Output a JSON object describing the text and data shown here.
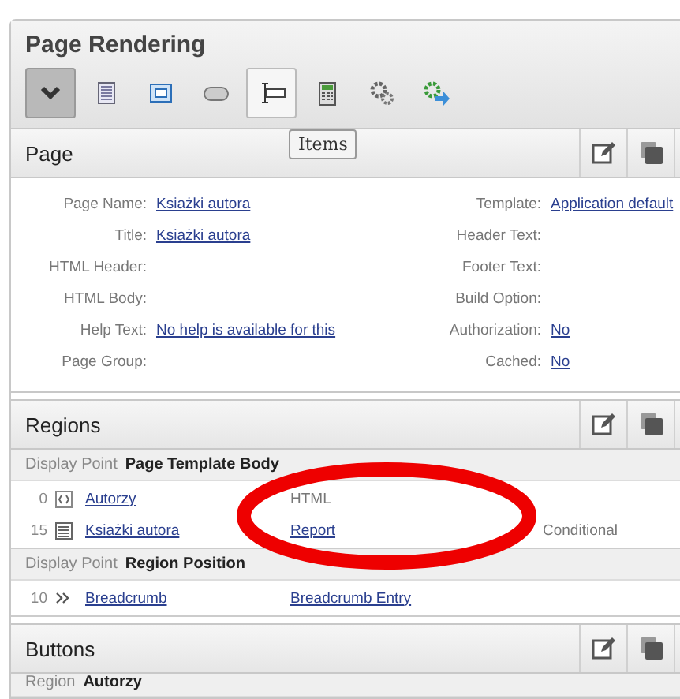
{
  "panel": {
    "title": "Page Rendering"
  },
  "toolbar": {
    "buttons": [
      {
        "kind": "collapse",
        "selected": true,
        "hovered": false
      },
      {
        "kind": "page",
        "selected": false,
        "hovered": false
      },
      {
        "kind": "region",
        "selected": false,
        "hovered": false
      },
      {
        "kind": "button",
        "selected": false,
        "hovered": false
      },
      {
        "kind": "items",
        "selected": false,
        "hovered": true
      },
      {
        "kind": "computation",
        "selected": false,
        "hovered": false
      },
      {
        "kind": "process",
        "selected": false,
        "hovered": false
      },
      {
        "kind": "branch",
        "selected": false,
        "hovered": false
      }
    ],
    "tooltip": "Items"
  },
  "page_section": {
    "title": "Page",
    "fields": [
      {
        "label": "Page Name:",
        "value": "Ksiażki autora",
        "label_2": "Template:",
        "value_2": "Application default"
      },
      {
        "label": "Title:",
        "value": "Ksiażki autora",
        "label_2": "Header Text:"
      },
      {
        "label": "HTML Header:",
        "label_2": "Footer Text:"
      },
      {
        "label": "HTML Body:",
        "label_2": "Build Option:"
      },
      {
        "label": "Help Text:",
        "value": "No help is available for this",
        "label_2": "Authorization:",
        "value_2": "No"
      },
      {
        "label": "Page Group:",
        "label_2": "Cached:",
        "value_2": "No"
      }
    ]
  },
  "regions": {
    "title": "Regions",
    "groups": [
      {
        "label": "Display Point",
        "value": "Page Template Body",
        "rows": [
          {
            "seq": "0",
            "kind": "html",
            "name": "Autorzy",
            "type": "HTML",
            "type_link": false
          },
          {
            "seq": "15",
            "kind": "report",
            "name": "Ksiażki autora",
            "type": "Report",
            "type_link": true,
            "condition": "Conditional"
          }
        ]
      },
      {
        "label": "Display Point",
        "value": "Region Position",
        "rows": [
          {
            "seq": "10",
            "kind": "breadcrumb",
            "name": "Breadcrumb",
            "type": "Breadcrumb Entry",
            "type_link": true
          }
        ]
      }
    ]
  },
  "buttons_section": {
    "title": "Buttons",
    "group": {
      "label": "Region",
      "value": "Autorzy"
    }
  }
}
